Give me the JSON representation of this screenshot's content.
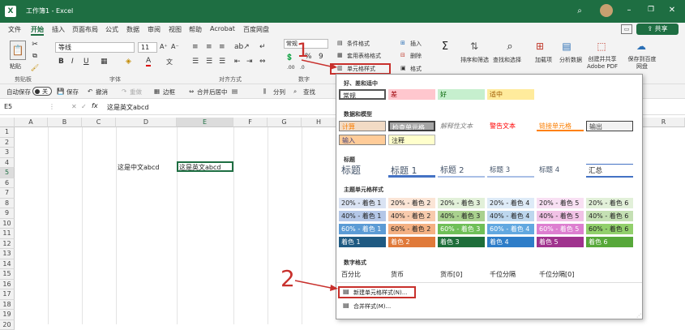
{
  "titlebar": {
    "autosave": "自动保存",
    "file_title": "工作簿1 - Excel",
    "share": "共享",
    "comment_icon": "comment-icon"
  },
  "menu": [
    "文件",
    "开始",
    "插入",
    "页面布局",
    "公式",
    "数据",
    "审阅",
    "视图",
    "帮助",
    "Acrobat",
    "百度网盘"
  ],
  "ribbon": {
    "paste": "粘贴",
    "clipboard": "剪贴板",
    "font_name": "等线",
    "font_size": "11",
    "font": "字体",
    "align": "对齐方式",
    "numfmt": "常规",
    "number": "数字",
    "cond_format": "条件格式",
    "table_format": "套用表格格式",
    "cell_style": "单元格样式",
    "insert": "插入",
    "delete": "删除",
    "format": "格式",
    "sort": "排序和筛选",
    "find": "查找和选择",
    "addin": "加载项",
    "analyze": "分析数据",
    "create_pdf": "创建并共享 Adobe PDF",
    "save_baidu": "保存到百度网盘"
  },
  "qat": {
    "autosave": "自动保存",
    "off": "关",
    "save": "保存",
    "undo": "撤消",
    "redo": "重做",
    "border": "边框",
    "merge": "合并后居中",
    "split": "分列",
    "find": "查找"
  },
  "formula": {
    "cell": "E5",
    "fx": "fx",
    "content": "这是英文abcd"
  },
  "grid": {
    "cols": [
      "A",
      "B",
      "C",
      "D",
      "E",
      "F",
      "G",
      "H"
    ],
    "rows": [
      "1",
      "2",
      "3",
      "4",
      "5",
      "6",
      "7",
      "8",
      "9",
      "10",
      "11",
      "12",
      "13",
      "14",
      "15",
      "16",
      "17",
      "18",
      "19",
      "20",
      "21"
    ],
    "d5": "这是中文abcd",
    "e5": "这是英文abcd",
    "extra_cols": [
      "R"
    ]
  },
  "panel": {
    "sec1": "好、差和适中",
    "normal": "常规",
    "bad": "差",
    "good": "好",
    "neutral": "适中",
    "sec2": "数据和模型",
    "calc": "计算",
    "check": "检查单元格",
    "explain": "解释性文本",
    "warn": "警告文本",
    "link": "链接单元格",
    "output": "输出",
    "input": "输入",
    "note": "注释",
    "sec3": "标题",
    "title": "标题",
    "h1": "标题 1",
    "h2": "标题 2",
    "h3": "标题 3",
    "h4": "标题 4",
    "total": "汇总",
    "sec4": "主题单元格样式",
    "r20": [
      "20% - 着色 1",
      "20% - 着色 2",
      "20% - 着色 3",
      "20% - 着色 4",
      "20% - 着色 5",
      "20% - 着色 6"
    ],
    "r40": [
      "40% - 着色 1",
      "40% - 着色 2",
      "40% - 着色 3",
      "40% - 着色 4",
      "40% - 着色 5",
      "40% - 着色 6"
    ],
    "r60": [
      "60% - 着色 1",
      "60% - 着色 2",
      "60% - 着色 3",
      "60% - 着色 4",
      "60% - 着色 5",
      "60% - 着色 6"
    ],
    "racc": [
      "着色 1",
      "着色 2",
      "着色 3",
      "着色 4",
      "着色 5",
      "着色 6"
    ],
    "sec5": "数字格式",
    "pct": "百分比",
    "cur": "货币",
    "cur0": "货币[0]",
    "thou": "千位分隔",
    "thou0": "千位分隔[0]",
    "new_style": "新建单元格样式(N)...",
    "merge_style": "合并样式(M)..."
  },
  "annotations": {
    "n1": "1",
    "n2": "2"
  },
  "colors": {
    "accent": "#1e6e42",
    "annotation": "#c8302c"
  }
}
